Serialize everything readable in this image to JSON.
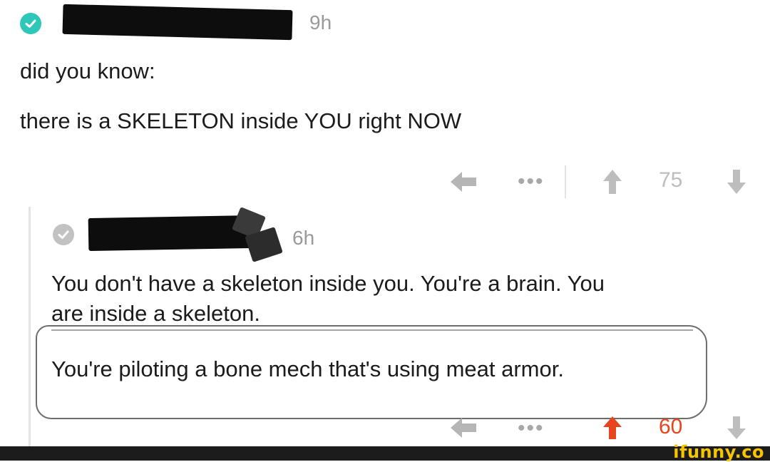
{
  "post": {
    "time": "9h",
    "line1": "did you know:",
    "line2": "there is a SKELETON inside YOU right NOW",
    "score": "75"
  },
  "reply": {
    "time": "6h",
    "line1": "You don't have a skeleton inside you. You're a brain. You",
    "line2": "are inside a skeleton.",
    "line3": "You're piloting a bone mech that's using meat armor.",
    "score": "60"
  },
  "actions": {
    "more": "•••"
  },
  "watermark": {
    "text": "ifunny.co"
  },
  "colors": {
    "verified": "#2fc7b8",
    "upvoted": "#e8441e",
    "brand": "#f7c400"
  },
  "icons": [
    "check-icon",
    "reply-arrow-icon",
    "more-icon",
    "upvote-icon",
    "downvote-icon"
  ]
}
